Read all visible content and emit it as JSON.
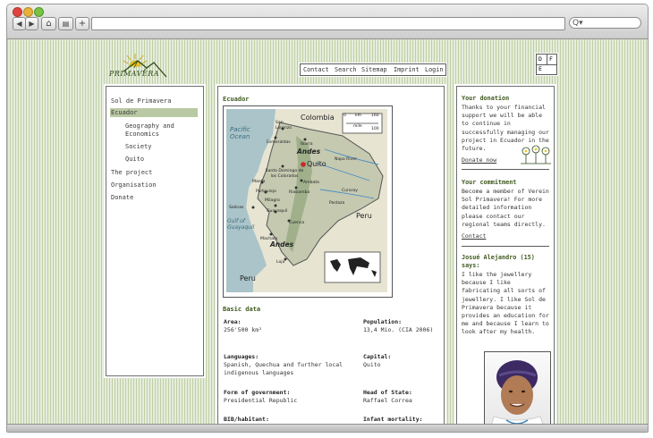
{
  "browser": {
    "back_glyph": "◀",
    "forward_glyph": "▶",
    "home_glyph": "⌂",
    "print_glyph": "▤",
    "add_glyph": "+",
    "search_glyph": "Q▾"
  },
  "site": {
    "logo_text": "PRIMAVERA",
    "top_nav": [
      "Contact",
      "Search",
      "Sitemap",
      "Imprint",
      "Login"
    ],
    "lang": [
      "D",
      "F",
      "E"
    ]
  },
  "sidebar": {
    "items": [
      {
        "label": "Sol de Primavera",
        "level": 0,
        "active": false
      },
      {
        "label": "Ecuador",
        "level": 0,
        "active": true
      },
      {
        "label": "Geography and Economics",
        "level": 1,
        "active": false
      },
      {
        "label": "Society",
        "level": 1,
        "active": false
      },
      {
        "label": "Quito",
        "level": 1,
        "active": false
      },
      {
        "label": "The project",
        "level": 0,
        "active": false
      },
      {
        "label": "Organisation",
        "level": 0,
        "active": false
      },
      {
        "label": "Donate",
        "level": 0,
        "active": false
      }
    ]
  },
  "main": {
    "heading": "Ecuador",
    "map_labels": {
      "colombia": "Colombia",
      "ocean": "Pacific Ocean",
      "andes1": "Andes",
      "andes2": "Andes",
      "quito": "Quito",
      "peru1": "Peru",
      "peru2": "Peru",
      "gulf": "Gulf of Guayaquil",
      "scale_km": "km",
      "scale_mile": "mile",
      "scale_0": "0",
      "scale_km_max": "160",
      "scale_mile_max": "100",
      "napo": "Napo River",
      "curaray": "Curaray",
      "pastaza": "Pastaza",
      "cities": [
        "San Lorenzo",
        "Esmeraldas",
        "Ibarra",
        "Santo Domingo de los Colorados",
        "Manta",
        "Portoviejo",
        "Milagro",
        "Salinas",
        "Guayaquil",
        "Ambato",
        "Riobamba",
        "Cuenca",
        "Machala",
        "Loja"
      ]
    },
    "basic_data_title": "Basic data",
    "facts": [
      {
        "label": "Area:",
        "value": "256'500 km²"
      },
      {
        "label": "Population:",
        "value": "13,4 Mio. (CIA 2006)"
      },
      {
        "label": "Languages:",
        "value": "Spanish, Quechua and further local indigenous languages"
      },
      {
        "label": "Capital:",
        "value": "Quito"
      },
      {
        "label": "Form of government:",
        "value": "Presidential Republic"
      },
      {
        "label": "Head of State:",
        "value": "Raffael Correa"
      },
      {
        "label": "BIB/habitant:",
        "value": ""
      },
      {
        "label": "Infant mortality:",
        "value": ""
      }
    ]
  },
  "right": {
    "donation_title": "Your donation",
    "donation_text": "Thanks to your financial support we will be able to continue in successfully managing our project in Ecuador in the future.",
    "donate_link": "Donate now",
    "commitment_title": "Your commitment",
    "commitment_text": "Become a member of Verein Sol Primavera! For more detailed information please contact our regional teams directly.",
    "contact_link": "Contact",
    "quote_author": "Josué Alejandro (15) says:",
    "quote_text": "I like the jewellery because I like fabricating all sorts of jewellery. I like Sol de Primavera because it provides an education for me and because I learn to look after my health."
  },
  "colors": {
    "accent_green": "#3f5a1f",
    "active_bg": "#b9c9a3",
    "stripe": "#bfcfa6"
  }
}
